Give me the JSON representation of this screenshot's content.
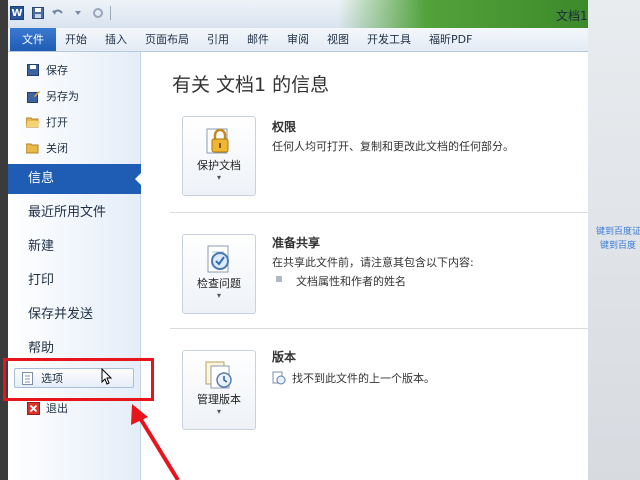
{
  "window": {
    "title": "文档1",
    "app_icon_letter": "W"
  },
  "ribbon": {
    "tabs": [
      "文件",
      "开始",
      "插入",
      "页面布局",
      "引用",
      "邮件",
      "审阅",
      "视图",
      "开发工具",
      "福昕PDF"
    ]
  },
  "backstage_nav": {
    "save": "保存",
    "save_as": "另存为",
    "open": "打开",
    "close": "关闭",
    "info": "信息",
    "recent": "最近所用文件",
    "new": "新建",
    "print": "打印",
    "save_send": "保存并发送",
    "help": "帮助",
    "options": "选项",
    "exit": "退出"
  },
  "info_page": {
    "title": "有关 文档1 的信息",
    "permissions": {
      "button": "保护文档",
      "heading": "权限",
      "text": "任何人均可打开、复制和更改此文档的任何部分。"
    },
    "prepare": {
      "button": "检查问题",
      "heading": "准备共享",
      "text": "在共享此文件前，请注意其包含以下内容:",
      "bullet": "文档属性和作者的姓名"
    },
    "versions": {
      "button": "管理版本",
      "heading": "版本",
      "text": "找不到此文件的上一个版本。"
    }
  },
  "backdrop": {
    "line1": "键到百度证",
    "line2": "键到百度"
  },
  "colors": {
    "accent_blue": "#1f5cb4",
    "highlight_red": "#e8141c",
    "title_green": "#52a23c"
  }
}
